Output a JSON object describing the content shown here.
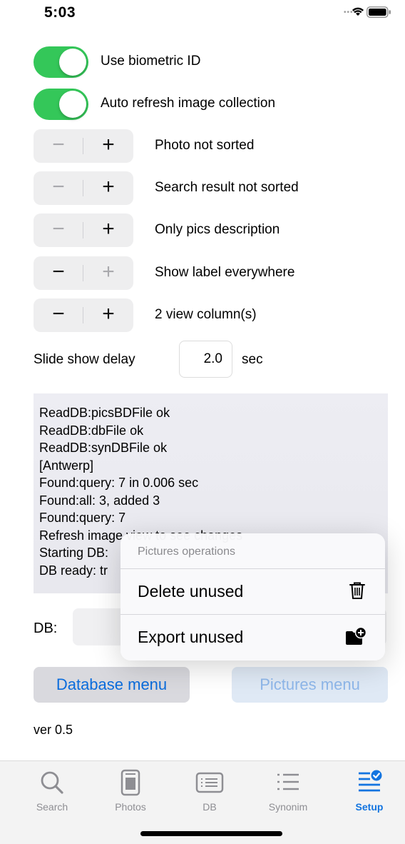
{
  "status_bar": {
    "time": "5:03"
  },
  "toggles": [
    {
      "label": "Use biometric ID",
      "on": true
    },
    {
      "label": "Auto refresh image collection",
      "on": true
    }
  ],
  "steppers": [
    {
      "label": "Photo not sorted",
      "minus_enabled": false,
      "plus_enabled": true
    },
    {
      "label": "Search result not sorted",
      "minus_enabled": false,
      "plus_enabled": true
    },
    {
      "label": "Only pics description",
      "minus_enabled": false,
      "plus_enabled": true
    },
    {
      "label": "Show label everywhere",
      "minus_enabled": true,
      "plus_enabled": false
    },
    {
      "label": "2 view column(s)",
      "minus_enabled": true,
      "plus_enabled": true
    }
  ],
  "slide_show": {
    "label": "Slide show delay",
    "value": "2.0",
    "unit": "sec"
  },
  "log_lines": [
    "ReadDB:picsBDFile ok",
    "ReadDB:dbFile ok",
    "ReadDB:synDBFile ok",
    "[Antwerp]",
    "Found:query: 7 in 0.006 sec",
    "Found:all: 3, added 3",
    "Found:query: 7",
    "Refresh image view to see changes",
    "Starting DB: ",
    "DB ready: tr"
  ],
  "db": {
    "label": "DB:",
    "value": ""
  },
  "buttons": {
    "database_menu": "Database menu",
    "pictures_menu": "Pictures menu"
  },
  "version": "ver 0.5",
  "popup_menu": {
    "header": "Pictures operations",
    "items": [
      {
        "label": "Delete unused",
        "icon": "trash-icon"
      },
      {
        "label": "Export unused",
        "icon": "folder-badge-plus-icon"
      }
    ]
  },
  "tabs": [
    {
      "label": "Search",
      "icon": "magnifier-icon",
      "active": false
    },
    {
      "label": "Photos",
      "icon": "photo-card-icon",
      "active": false
    },
    {
      "label": "DB",
      "icon": "list-card-icon",
      "active": false
    },
    {
      "label": "Synonim",
      "icon": "bullet-list-icon",
      "active": false
    },
    {
      "label": "Setup",
      "icon": "checklist-icon",
      "active": true
    }
  ],
  "colors": {
    "toggle_on": "#34c759",
    "accent": "#0a6cdc",
    "tab_active": "#1374e0"
  }
}
